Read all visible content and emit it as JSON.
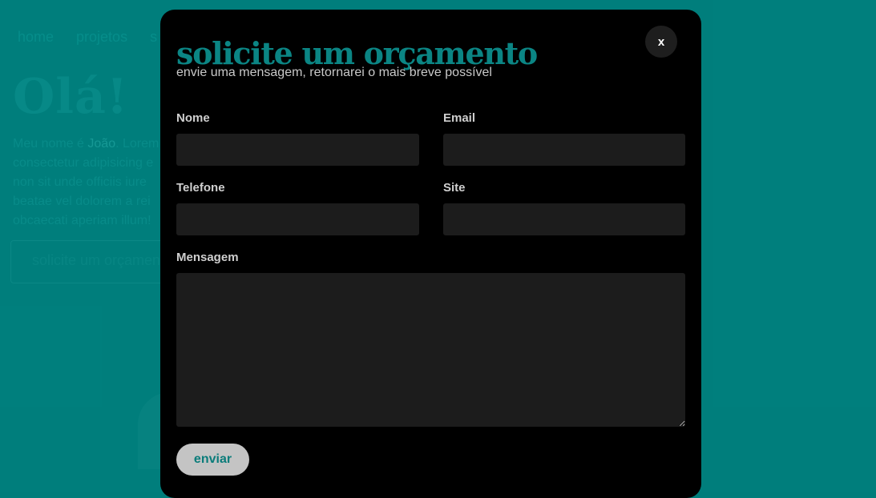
{
  "background": {
    "nav": [
      "home",
      "projetos",
      "s"
    ],
    "hello": "Olá!",
    "intro_prefix": "Meu nome é ",
    "intro_name": "João",
    "intro_rest": ". Lorem\nconsectetur adipisicing e\nnon sit unde officiis iure\nbeatae vel dolorem a rei\nobcaecati aperiam illum!",
    "cta": "solicite um orçamento"
  },
  "modal": {
    "title": "solicite um orçamento",
    "subtitle": "envie uma mensagem, retornarei o mais breve possível",
    "close_label": "x",
    "fields": {
      "name_label": "Nome",
      "email_label": "Email",
      "phone_label": "Telefone",
      "site_label": "Site",
      "message_label": "Mensagem"
    },
    "submit_label": "enviar"
  },
  "colors": {
    "accent": "#0b8584",
    "page_bg": "#008280",
    "modal_bg": "#000000",
    "field_bg": "#1c1c1c"
  }
}
